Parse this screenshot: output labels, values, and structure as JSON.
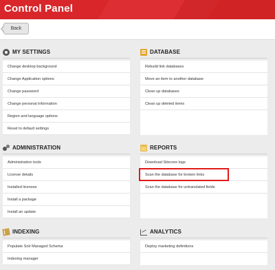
{
  "header": {
    "title": "Control Panel"
  },
  "toolbar": {
    "back_label": "Back"
  },
  "sections": {
    "my_settings": {
      "title": "MY SETTINGS",
      "icon": "gear-icon",
      "items": [
        "Change desktop background",
        "Change Application options",
        "Change password",
        "Change personal information",
        "Region and language options",
        "Reset to default settings"
      ]
    },
    "database": {
      "title": "DATABASE",
      "icon": "database-icon",
      "items": [
        "Rebuild link databases",
        "Move an item to another database",
        "Clean up databases",
        "Clean up deleted items"
      ]
    },
    "administration": {
      "title": "ADMINISTRATION",
      "icon": "gears-icon",
      "items": [
        "Administration tools",
        "License details",
        "Installed licenses",
        "Install a package",
        "Install an update"
      ]
    },
    "reports": {
      "title": "REPORTS",
      "icon": "folder-icon",
      "items": [
        "Download Sitecore logs",
        "Scan the database for broken links",
        "Scan the database for untranslated fields"
      ]
    },
    "indexing": {
      "title": "INDEXING",
      "icon": "indexing-icon",
      "items": [
        "Populate Solr Managed Schema",
        "Indexing manager"
      ]
    },
    "analytics": {
      "title": "ANALYTICS",
      "icon": "chart-icon",
      "items": [
        "Deploy marketing definitions"
      ]
    }
  },
  "colors": {
    "header": "#d8262a",
    "highlight": "#e01818"
  }
}
